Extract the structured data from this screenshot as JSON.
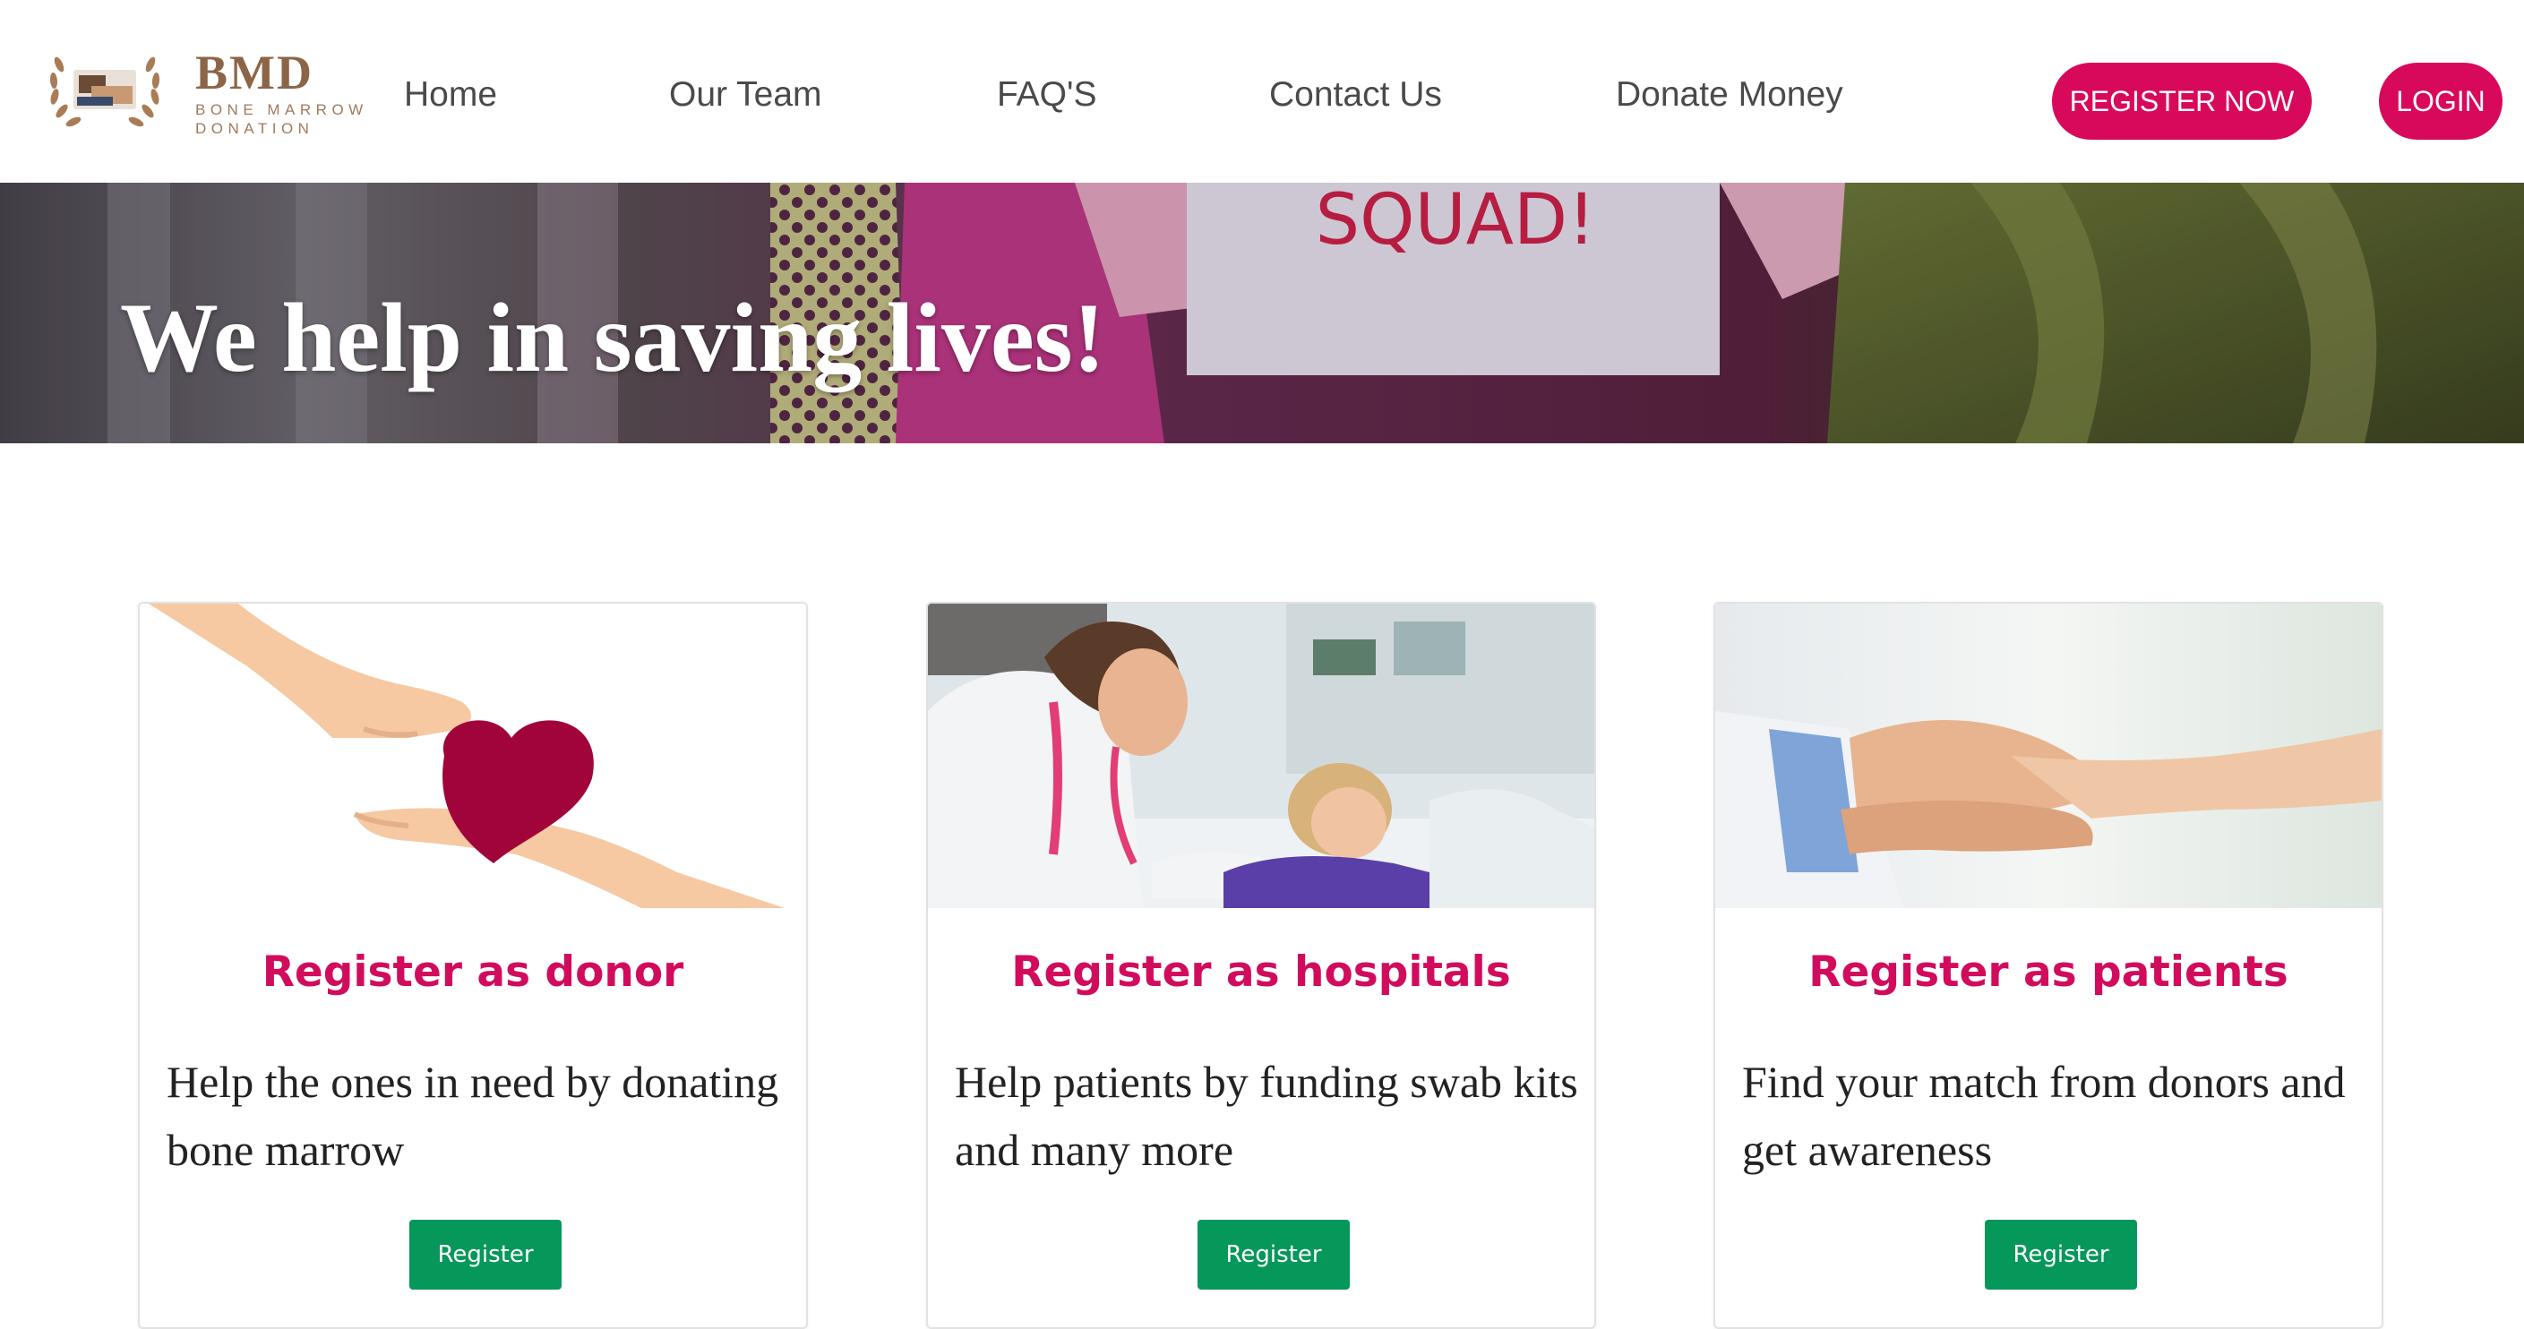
{
  "brand": {
    "logo_title": "BMD",
    "logo_subtitle": "Bone Marrow Donation",
    "logo_icon": "laurel-wreath-logo-icon"
  },
  "nav": {
    "items": [
      {
        "label": "Home"
      },
      {
        "label": "Our Team"
      },
      {
        "label": "FAQ'S"
      },
      {
        "label": "Contact Us"
      },
      {
        "label": "Donate Money"
      }
    ],
    "register_now": "REGISTER NOW",
    "login": "LOGIN"
  },
  "hero": {
    "title": "We help in saving lives!",
    "sign_text": "SQUAD!"
  },
  "cards": [
    {
      "title": "Register as donor",
      "text": "Help the ones in need by donating bone marrow",
      "button": "Register",
      "image": "hands-giving-heart-illustration"
    },
    {
      "title": "Register as hospitals",
      "text": "Help patients by funding swab kits and many more",
      "button": "Register",
      "image": "doctor-with-child-patient-photo"
    },
    {
      "title": "Register as patients",
      "text": "Find your match from donors and get awareness",
      "button": "Register",
      "image": "holding-hands-photo"
    }
  ],
  "colors": {
    "accent_pink": "#d8095a",
    "card_title_pink": "#d20c5d",
    "button_green": "#06975a",
    "logo_brown": "#8c6547",
    "nav_text": "#4a4a4a"
  }
}
